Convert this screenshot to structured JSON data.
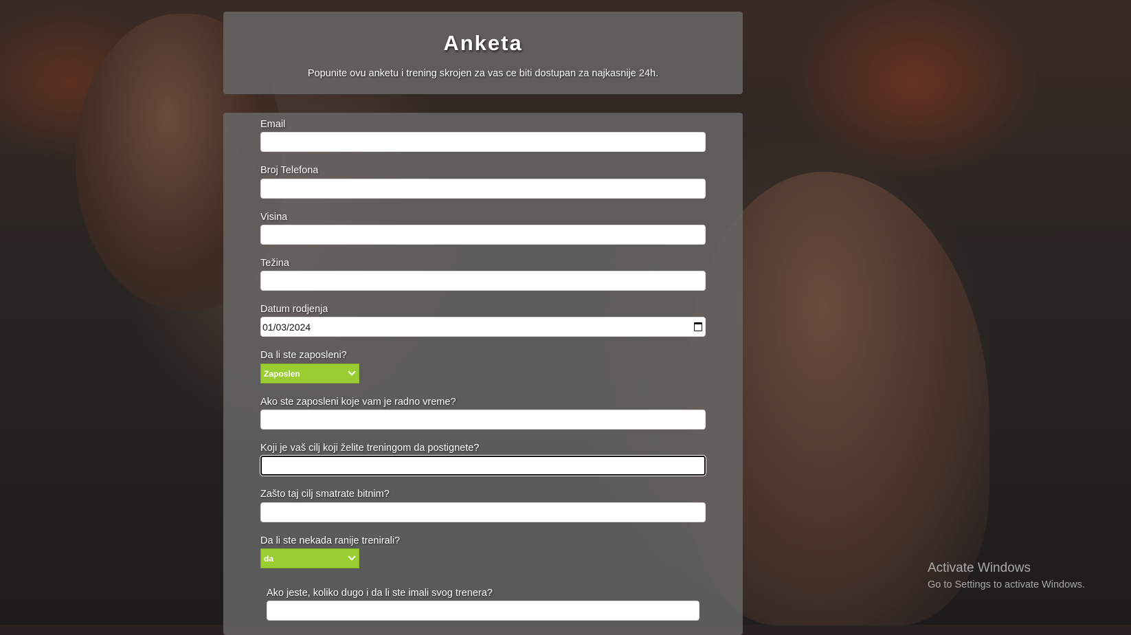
{
  "header": {
    "title": "Anketa",
    "subtitle": "Popunite ovu anketu i trening skrojen za vas ce biti dostupan za najkasnije 24h."
  },
  "form": {
    "email_label": "Email",
    "phone_label": "Broj Telefona",
    "height_label": "Visina",
    "weight_label": "Težina",
    "birthdate_label": "Datum rodjenja",
    "birthdate_value": "01/03/2024",
    "employed_label": "Da li ste zaposleni?",
    "employed_value": "Zaposlen",
    "work_hours_label": "Ako ste zaposleni koje vam je radno vreme?",
    "goal_label": "Koji je vaš cilj koji želite treningom da postignete?",
    "goal_reason_label": "Zašto taj cilj smatrate bitnim?",
    "trained_before_label": "Da li ste nekada ranije trenirali?",
    "trained_before_value": "da",
    "training_duration_label": "Ako jeste, koliko dugo i da li ste imali svog trenera?"
  },
  "watermark": {
    "line1": "Activate Windows",
    "line2": "Go to Settings to activate Windows."
  },
  "colors": {
    "panel": "#696969",
    "select_accent": "#9acd32"
  }
}
